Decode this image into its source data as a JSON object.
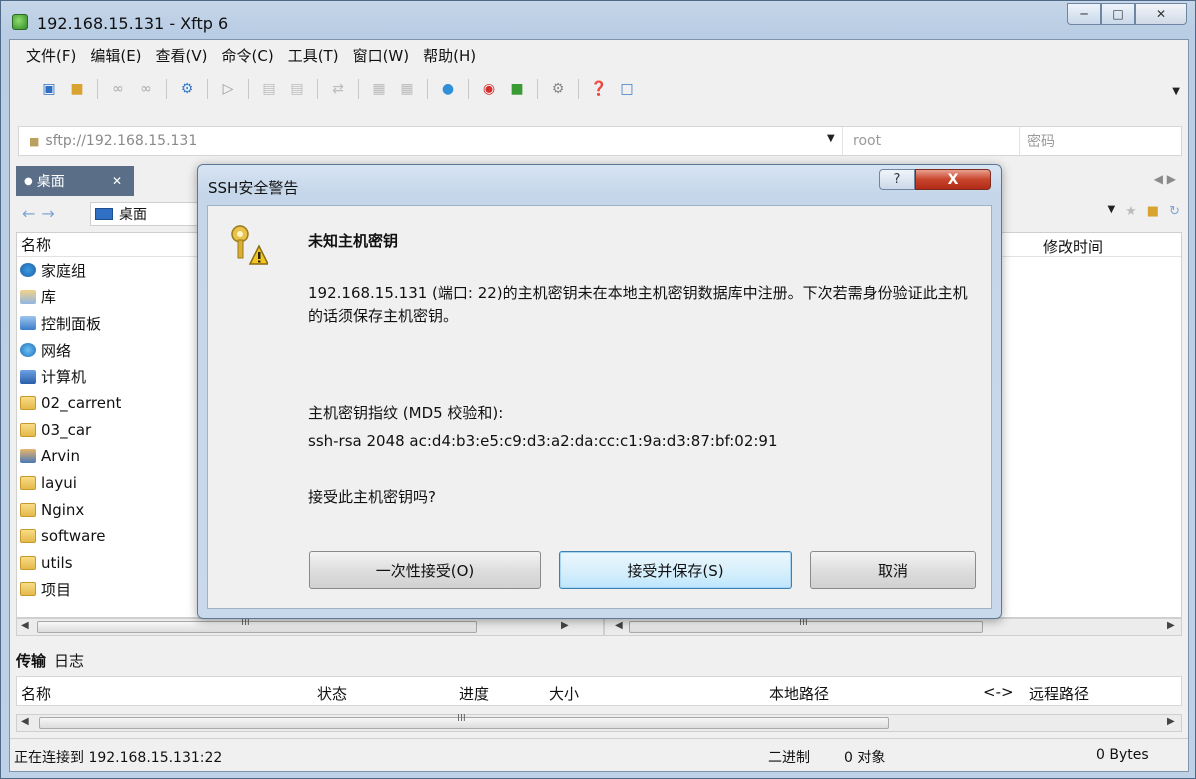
{
  "window": {
    "title": "192.168.15.131   - Xftp 6"
  },
  "menu": [
    "文件(F)",
    "编辑(E)",
    "查看(V)",
    "命令(C)",
    "工具(T)",
    "窗口(W)",
    "帮助(H)"
  ],
  "address": {
    "url": "sftp://192.168.15.131",
    "user_placeholder": "root",
    "password_placeholder": "密码"
  },
  "tab": {
    "label": "桌面"
  },
  "nav": {
    "path": "桌面"
  },
  "left_pane": {
    "column_name": "名称",
    "items": [
      {
        "label": "家庭组",
        "icon": "home"
      },
      {
        "label": "库",
        "icon": "lib"
      },
      {
        "label": "控制面板",
        "icon": "cp"
      },
      {
        "label": "网络",
        "icon": "net"
      },
      {
        "label": "计算机",
        "icon": "pc"
      },
      {
        "label": "02_carrent",
        "icon": "folder"
      },
      {
        "label": "03_car",
        "icon": "folder"
      },
      {
        "label": "Arvin",
        "icon": "user"
      },
      {
        "label": "layui",
        "icon": "folder"
      },
      {
        "label": "Nginx",
        "icon": "folder"
      },
      {
        "label": "software",
        "icon": "folder"
      },
      {
        "label": "utils",
        "icon": "folder"
      },
      {
        "label": "项目",
        "icon": "folder"
      }
    ]
  },
  "right_pane": {
    "column_modified": "修改时间"
  },
  "transfer": {
    "tabs": [
      "传输",
      "日志"
    ],
    "columns": {
      "name": "名称",
      "status": "状态",
      "progress": "进度",
      "size": "大小",
      "local": "本地路径",
      "arrow": "<->",
      "remote": "远程路径"
    }
  },
  "status": {
    "connecting": "正在连接到 192.168.15.131:22",
    "mode": "二进制",
    "objects": "0 对象",
    "bytes": "0 Bytes"
  },
  "dialog": {
    "title": "SSH安全警告",
    "heading": "未知主机密钥",
    "message": "192.168.15.131 (端口: 22)的主机密钥未在本地主机密钥数据库中注册。下次若需身份验证此主机的话须保存主机密钥。",
    "fingerprint_label": "主机密钥指纹 (MD5 校验和):",
    "fingerprint": "ssh-rsa 2048 ac:d4:b3:e5:c9:d3:a2:da:cc:c1:9a:d3:87:bf:02:91",
    "question": "接受此主机密钥吗?",
    "buttons": {
      "once": "一次性接受(O)",
      "save": "接受并保存(S)",
      "cancel": "取消"
    },
    "help_glyph": "?",
    "close_glyph": "X"
  }
}
